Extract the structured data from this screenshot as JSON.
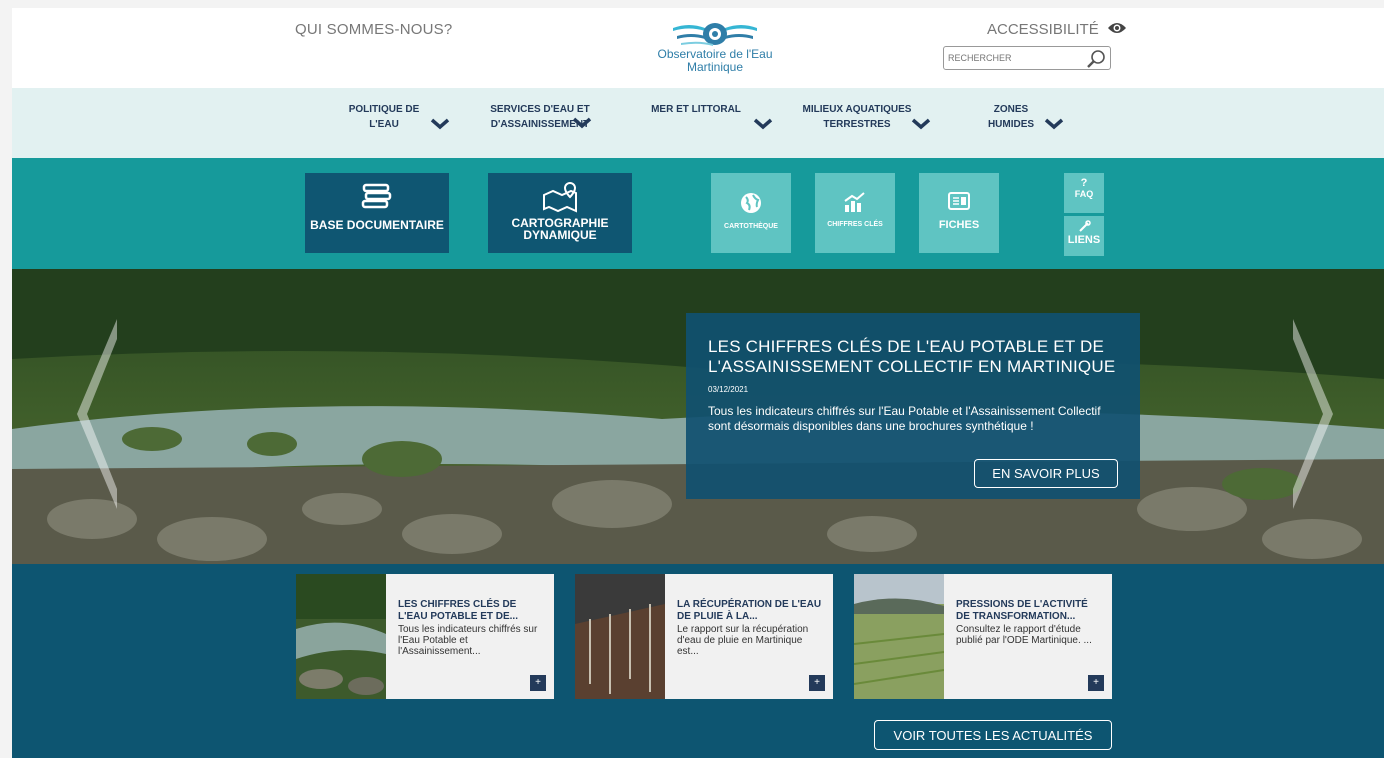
{
  "header": {
    "about": "QUI SOMMES-NOUS?",
    "logo_line1": "Observatoire de l'Eau",
    "logo_line2": "Martinique",
    "accessibility": "ACCESSIBILITÉ",
    "search_placeholder": "RECHERCHER"
  },
  "nav": {
    "items": [
      {
        "label": "POLITIQUE DE L'EAU"
      },
      {
        "label": "SERVICES D'EAU ET D'ASSAINISSEMENT"
      },
      {
        "label": "MER ET LITTORAL"
      },
      {
        "label": "MILIEUX AQUATIQUES TERRESTRES"
      },
      {
        "label": "ZONES HUMIDES"
      }
    ]
  },
  "tools": {
    "base_doc": "BASE DOCUMENTAIRE",
    "cartographie": "CARTOGRAPHIE DYNAMIQUE",
    "cartotheque": "CARTOTHÈQUE",
    "chiffres": "CHIFFRES CLÉS",
    "fiches": "FICHES",
    "faq_mark": "?",
    "faq": "FAQ",
    "liens": "LIENS"
  },
  "hero": {
    "title": "LES CHIFFRES CLÉS DE L'EAU POTABLE ET DE L'ASSAINISSEMENT COLLECTIF EN MARTINIQUE",
    "date": "03/12/2021",
    "text": "Tous les indicateurs chiffrés sur l'Eau Potable et l'Assainissement Collectif sont désormais disponibles dans une brochures synthétique !",
    "button": "EN SAVOIR PLUS"
  },
  "news": {
    "cards": [
      {
        "title": "LES CHIFFRES CLÉS DE L'EAU POTABLE ET DE...",
        "text": "Tous les indicateurs chiffrés sur l'Eau Potable et l'Assainissement...",
        "plus": "+"
      },
      {
        "title": "LA RÉCUPÉRATION DE L'EAU DE PLUIE À LA...",
        "text": "Le rapport sur la récupération d'eau de pluie en Martinique est...",
        "plus": "+"
      },
      {
        "title": "PRESSIONS DE L'ACTIVITÉ DE TRANSFORMATION...",
        "text": "Consultez le rapport d'étude publié par l'ODE Martinique. ...",
        "plus": "+"
      }
    ],
    "all_button": "VOIR TOUTES LES ACTUALITÉS"
  },
  "icons": [
    "water-eye-logo-icon",
    "eye-icon",
    "search-icon",
    "chevron-down-icon",
    "books-icon",
    "map-pin-icon",
    "globe-icon",
    "chart-icon",
    "document-icon",
    "link-icon",
    "chevron-left-icon",
    "chevron-right-icon",
    "plus-icon"
  ],
  "colors": {
    "nav_bg": "#e2f1f1",
    "tools_bg": "#169a9b",
    "dark_tile": "#0f5672",
    "light_tile": "#5fc4c2",
    "news_bg": "#0d5571",
    "title_text": "#233a5a"
  }
}
